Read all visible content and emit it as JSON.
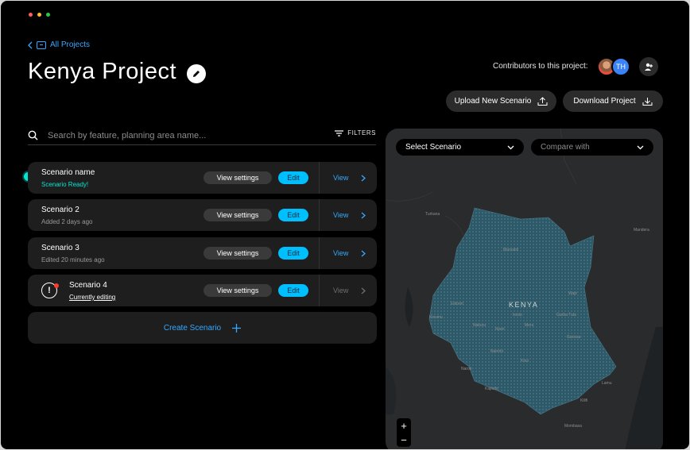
{
  "window": {
    "traffic_colors": [
      "#ff5f57",
      "#febc2e",
      "#28c840"
    ]
  },
  "header": {
    "back_label": "All Projects",
    "title": "Kenya Project",
    "contributors_label": "Contributors to this project:",
    "avatar_initials": "TH",
    "upload_label": "Upload New Scenario",
    "download_label": "Download Project"
  },
  "search": {
    "placeholder": "Search by feature, planning area name...",
    "filters_label": "FILTERS"
  },
  "scenarios": [
    {
      "name": "Scenario name",
      "status": "Scenario Ready!",
      "view_settings": "View settings",
      "edit": "Edit",
      "view": "View"
    },
    {
      "name": "Scenario 2",
      "status": "Added 2 days ago",
      "view_settings": "View settings",
      "edit": "Edit",
      "view": "View"
    },
    {
      "name": "Scenario 3",
      "status": "Edited 20 minutes ago",
      "view_settings": "View settings",
      "edit": "Edit",
      "view": "View"
    },
    {
      "name": "Scenario 4",
      "status": "Currently editing",
      "view_settings": "View settings",
      "edit": "Edit",
      "view": "View"
    }
  ],
  "create_label": "Create Scenario",
  "map": {
    "select_scenario": "Select Scenario",
    "compare_with": "Compare with",
    "country_label": "KENYA",
    "zoom_in": "+",
    "zoom_out": "−",
    "place_labels": [
      "Turkana",
      "Marsabit",
      "Wajir",
      "Garissa",
      "Isiolo",
      "Meru",
      "Nyeri",
      "Nakuru",
      "Nairobi",
      "Kisumu",
      "Kitui",
      "Mombasa",
      "Lamu",
      "Kilifi",
      "Kajiado",
      "Narok",
      "Eldoret",
      "Garba Tula",
      "Mandera"
    ]
  },
  "colors": {
    "accent": "#33a9ff",
    "edit": "#00bfff",
    "ready": "#03e7d1",
    "alert": "#ff3b30"
  }
}
